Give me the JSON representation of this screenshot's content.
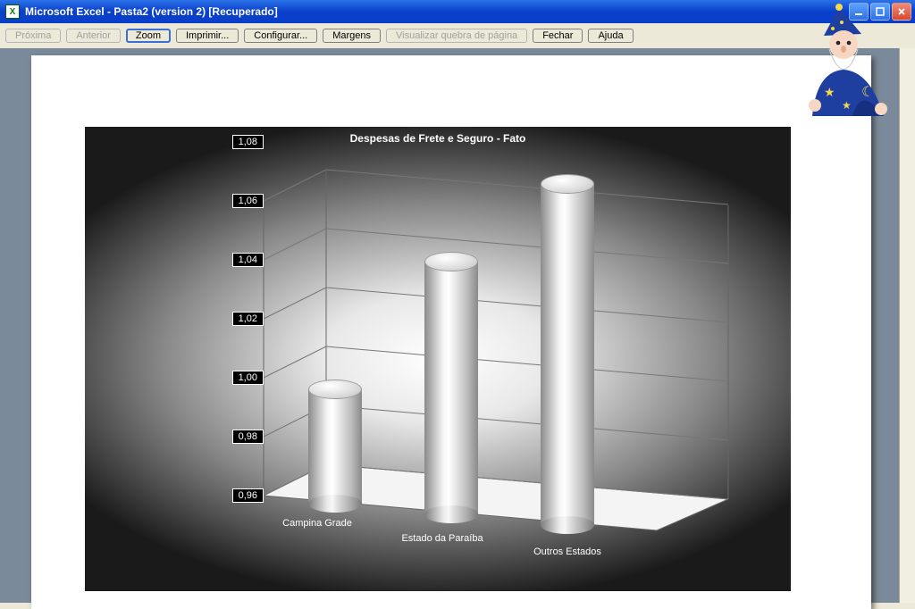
{
  "window": {
    "title": "Microsoft Excel - Pasta2 (version 2)  [Recuperado]",
    "app_icon_letter": "X"
  },
  "toolbar": {
    "proxima": "Próxima",
    "anterior": "Anterior",
    "zoom": "Zoom",
    "imprimir": "Imprimir...",
    "configurar": "Configurar...",
    "margens": "Margens",
    "visualizar_quebra": "Visualizar quebra de página",
    "fechar": "Fechar",
    "ajuda": "Ajuda"
  },
  "chart_data": {
    "type": "bar",
    "title": "Despesas de Frete e Seguro - Fato",
    "categories": [
      "Campina Grade",
      "Estado da Paraíba",
      "Outros Estados"
    ],
    "values": [
      1.0,
      1.047,
      1.077
    ],
    "ylim": [
      0.96,
      1.08
    ],
    "yticks": [
      0.96,
      0.98,
      1.0,
      1.02,
      1.04,
      1.06,
      1.08
    ],
    "ytick_labels": [
      "0,96",
      "0,98",
      "1,00",
      "1,02",
      "1,04",
      "1,06",
      "1,08"
    ],
    "xlabel": "",
    "ylabel": ""
  },
  "assistant": {
    "name": "Merlin"
  }
}
